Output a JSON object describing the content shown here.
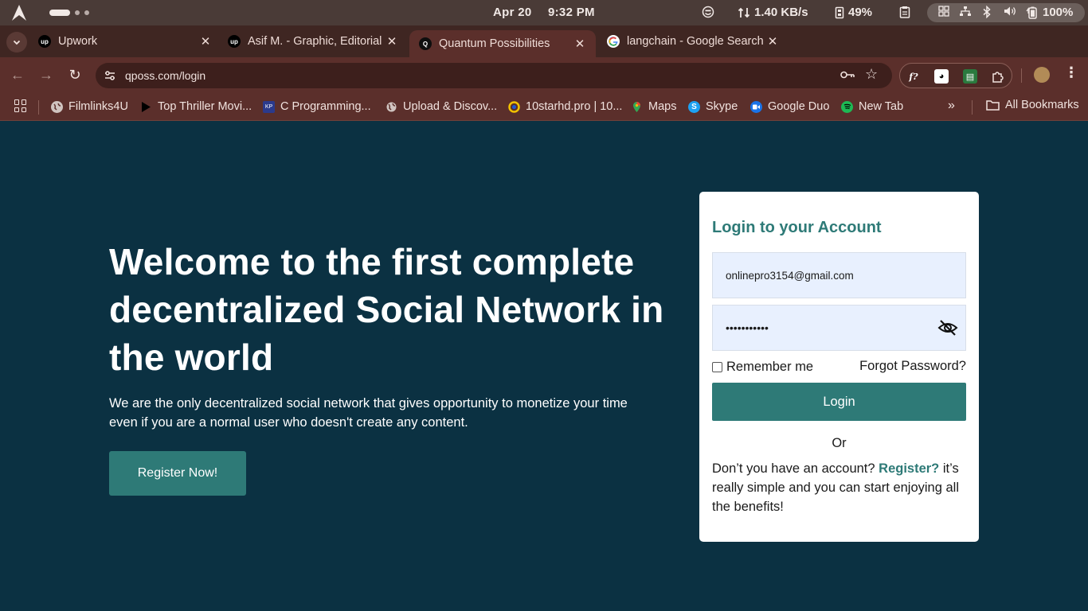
{
  "os": {
    "date": "Apr 20",
    "time": "9:32 PM",
    "net_speed": "1.40 KB/s",
    "memory": "49%",
    "battery": "100%"
  },
  "tabs": [
    {
      "title": "Upwork",
      "favicon": "upwork-icon",
      "active": false
    },
    {
      "title": "Asif M. - Graphic, Editorial",
      "favicon": "upwork-icon",
      "active": false
    },
    {
      "title": "Quantum Possibilities",
      "favicon": "qposs-icon",
      "active": true
    },
    {
      "title": "langchain - Google Search",
      "favicon": "google-icon",
      "active": false
    }
  ],
  "toolbar": {
    "url": "qposs.com/login"
  },
  "bookmarks": {
    "items": [
      {
        "label": "Filmlinks4U",
        "icon": "globe-icon"
      },
      {
        "label": "Top Thriller Movi...",
        "icon": "play-icon"
      },
      {
        "label": "C Programming...",
        "icon": "kp-icon"
      },
      {
        "label": "Upload & Discov...",
        "icon": "globe-icon"
      },
      {
        "label": "10starhd.pro | 10...",
        "icon": "site-icon"
      },
      {
        "label": "Maps",
        "icon": "maps-icon"
      },
      {
        "label": "Skype",
        "icon": "skype-icon"
      },
      {
        "label": "Google Duo",
        "icon": "duo-icon"
      },
      {
        "label": "New Tab",
        "icon": "spotify-icon"
      }
    ],
    "all_bookmarks": "All Bookmarks"
  },
  "hero": {
    "title": "Welcome to the first complete decentralized Social Network in the world",
    "subtitle": "We are the only decentralized social network that gives opportunity to monetize your time even if you are a normal user who doesn't create any content.",
    "register_label": "Register Now!"
  },
  "login": {
    "title": "Login to your Account",
    "email_value": "onlinepro3154@gmail.com",
    "password_value": "•••••••••••",
    "remember_label": "Remember me",
    "forgot_label": "Forgot Password?",
    "login_label": "Login",
    "or_label": "Or",
    "signup_prefix": "Don’t you have an account?",
    "signup_link": "Register?",
    "signup_suffix": "it’s really simple and you can start enjoying all the benefits!"
  },
  "colors": {
    "page_bg": "#0b3142",
    "accent": "#2e7a77",
    "chrome_bg": "#5b2f2b"
  }
}
